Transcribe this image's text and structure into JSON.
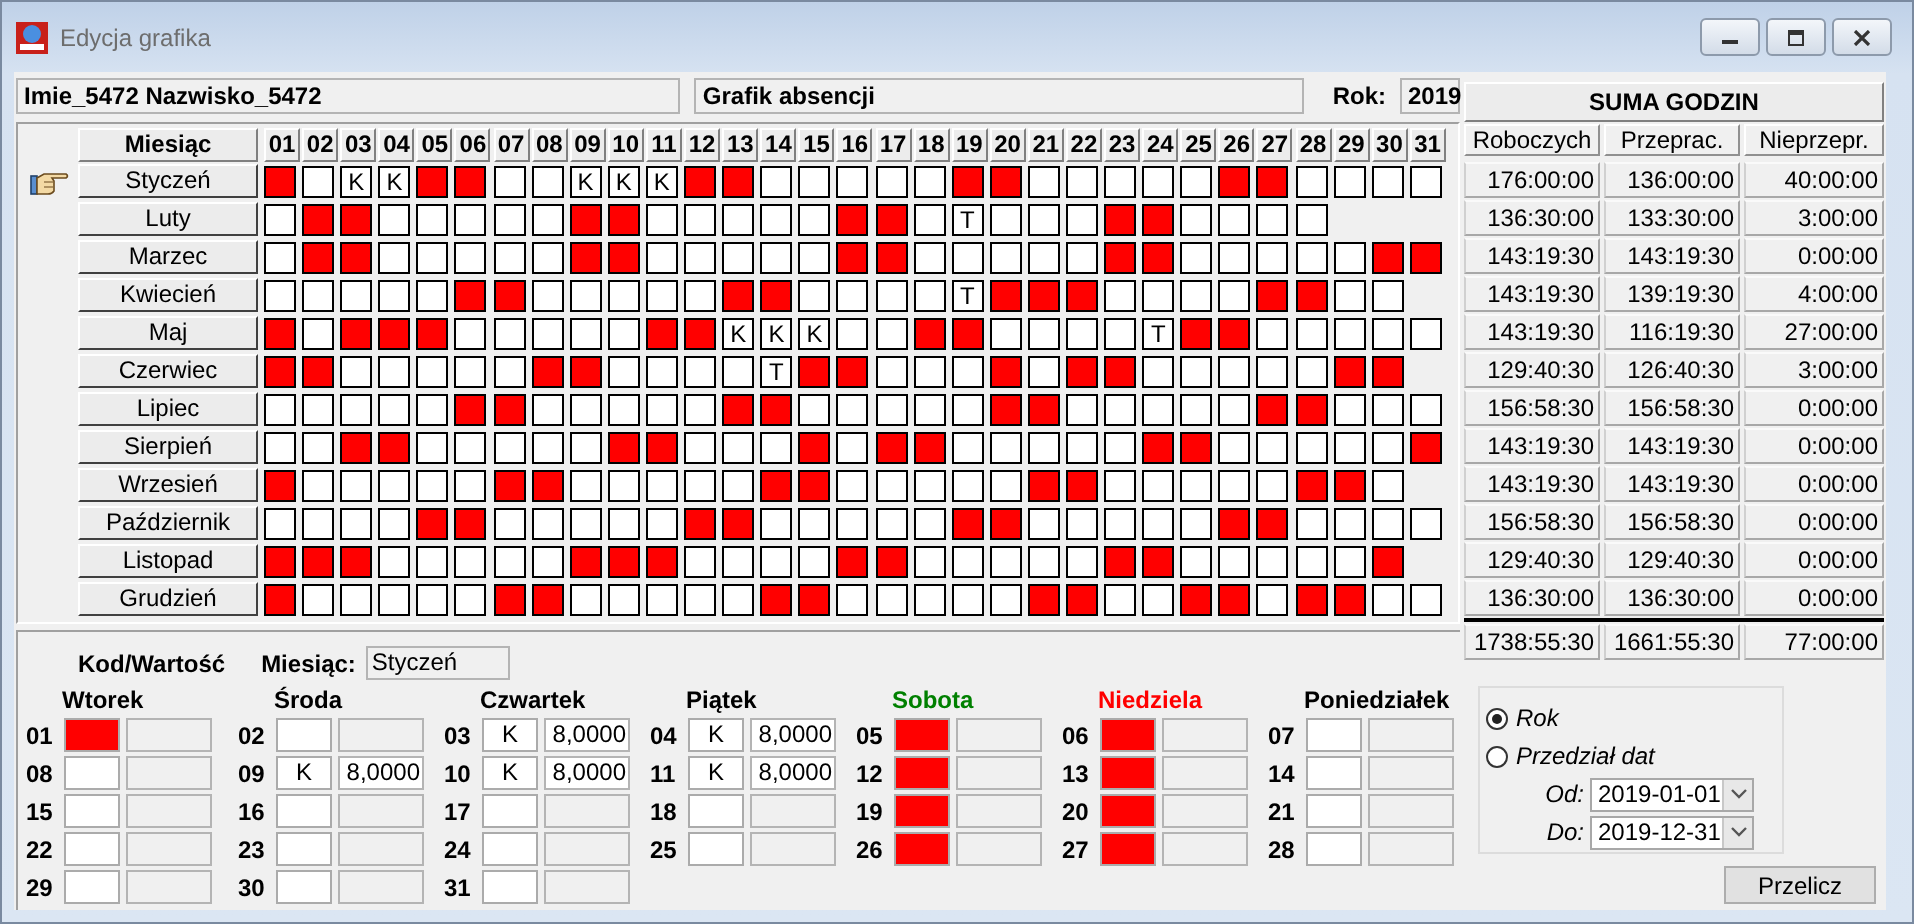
{
  "window": {
    "title": "Edycja grafika"
  },
  "header": {
    "employee": "Imie_5472 Nazwisko_5472",
    "schedule": "Grafik absencji",
    "year_label": "Rok:",
    "year": "2019"
  },
  "grid": {
    "month_heading": "Miesiąc",
    "day_headings": [
      "01",
      "02",
      "03",
      "04",
      "05",
      "06",
      "07",
      "08",
      "09",
      "10",
      "11",
      "12",
      "13",
      "14",
      "15",
      "16",
      "17",
      "18",
      "19",
      "20",
      "21",
      "22",
      "23",
      "24",
      "25",
      "26",
      "27",
      "28",
      "29",
      "30",
      "31"
    ],
    "months": [
      {
        "name": "Styczeń",
        "selected": true,
        "days": [
          {
            "off": true
          },
          {
            "off": false
          },
          {
            "off": false,
            "code": "K"
          },
          {
            "off": false,
            "code": "K"
          },
          {
            "off": true
          },
          {
            "off": true
          },
          {
            "off": false
          },
          {
            "off": false
          },
          {
            "off": false,
            "code": "K"
          },
          {
            "off": false,
            "code": "K"
          },
          {
            "off": false,
            "code": "K"
          },
          {
            "off": true
          },
          {
            "off": true
          },
          {
            "off": false
          },
          {
            "off": false
          },
          {
            "off": false
          },
          {
            "off": false
          },
          {
            "off": false
          },
          {
            "off": true
          },
          {
            "off": true
          },
          {
            "off": false
          },
          {
            "off": false
          },
          {
            "off": false
          },
          {
            "off": false
          },
          {
            "off": false
          },
          {
            "off": true
          },
          {
            "off": true
          },
          {
            "off": false
          },
          {
            "off": false
          },
          {
            "off": false
          },
          {
            "off": false
          }
        ]
      },
      {
        "name": "Luty",
        "selected": false,
        "days": [
          {
            "off": false
          },
          {
            "off": true
          },
          {
            "off": true
          },
          {
            "off": false
          },
          {
            "off": false
          },
          {
            "off": false
          },
          {
            "off": false
          },
          {
            "off": false
          },
          {
            "off": true
          },
          {
            "off": true
          },
          {
            "off": false
          },
          {
            "off": false
          },
          {
            "off": false
          },
          {
            "off": false
          },
          {
            "off": false
          },
          {
            "off": true
          },
          {
            "off": true
          },
          {
            "off": false
          },
          {
            "off": false,
            "code": "T"
          },
          {
            "off": false
          },
          {
            "off": false
          },
          {
            "off": false
          },
          {
            "off": true
          },
          {
            "off": true
          },
          {
            "off": false
          },
          {
            "off": false
          },
          {
            "off": false
          },
          {
            "off": false
          }
        ]
      },
      {
        "name": "Marzec",
        "selected": false,
        "days": [
          {
            "off": false
          },
          {
            "off": true
          },
          {
            "off": true
          },
          {
            "off": false
          },
          {
            "off": false
          },
          {
            "off": false
          },
          {
            "off": false
          },
          {
            "off": false
          },
          {
            "off": true
          },
          {
            "off": true
          },
          {
            "off": false
          },
          {
            "off": false
          },
          {
            "off": false
          },
          {
            "off": false
          },
          {
            "off": false
          },
          {
            "off": true
          },
          {
            "off": true
          },
          {
            "off": false
          },
          {
            "off": false
          },
          {
            "off": false
          },
          {
            "off": false
          },
          {
            "off": false
          },
          {
            "off": true
          },
          {
            "off": true
          },
          {
            "off": false
          },
          {
            "off": false
          },
          {
            "off": false
          },
          {
            "off": false
          },
          {
            "off": false
          },
          {
            "off": true
          },
          {
            "off": true
          }
        ]
      },
      {
        "name": "Kwiecień",
        "selected": false,
        "days": [
          {
            "off": false
          },
          {
            "off": false
          },
          {
            "off": false
          },
          {
            "off": false
          },
          {
            "off": false
          },
          {
            "off": true
          },
          {
            "off": true
          },
          {
            "off": false
          },
          {
            "off": false
          },
          {
            "off": false
          },
          {
            "off": false
          },
          {
            "off": false
          },
          {
            "off": true
          },
          {
            "off": true
          },
          {
            "off": false
          },
          {
            "off": false
          },
          {
            "off": false
          },
          {
            "off": false
          },
          {
            "off": false,
            "code": "T"
          },
          {
            "off": true
          },
          {
            "off": true
          },
          {
            "off": true
          },
          {
            "off": false
          },
          {
            "off": false
          },
          {
            "off": false
          },
          {
            "off": false
          },
          {
            "off": true
          },
          {
            "off": true
          },
          {
            "off": false
          },
          {
            "off": false
          }
        ]
      },
      {
        "name": "Maj",
        "selected": false,
        "days": [
          {
            "off": true
          },
          {
            "off": false
          },
          {
            "off": true
          },
          {
            "off": true
          },
          {
            "off": true
          },
          {
            "off": false
          },
          {
            "off": false
          },
          {
            "off": false
          },
          {
            "off": false
          },
          {
            "off": false
          },
          {
            "off": true
          },
          {
            "off": true
          },
          {
            "off": false,
            "code": "K"
          },
          {
            "off": false,
            "code": "K"
          },
          {
            "off": false,
            "code": "K"
          },
          {
            "off": false
          },
          {
            "off": false
          },
          {
            "off": true
          },
          {
            "off": true
          },
          {
            "off": false
          },
          {
            "off": false
          },
          {
            "off": false
          },
          {
            "off": false
          },
          {
            "off": false,
            "code": "T"
          },
          {
            "off": true
          },
          {
            "off": true
          },
          {
            "off": false
          },
          {
            "off": false
          },
          {
            "off": false
          },
          {
            "off": false
          },
          {
            "off": false
          }
        ]
      },
      {
        "name": "Czerwiec",
        "selected": false,
        "days": [
          {
            "off": true
          },
          {
            "off": true
          },
          {
            "off": false
          },
          {
            "off": false
          },
          {
            "off": false
          },
          {
            "off": false
          },
          {
            "off": false
          },
          {
            "off": true
          },
          {
            "off": true
          },
          {
            "off": false
          },
          {
            "off": false
          },
          {
            "off": false
          },
          {
            "off": false
          },
          {
            "off": false,
            "code": "T"
          },
          {
            "off": true
          },
          {
            "off": true
          },
          {
            "off": false
          },
          {
            "off": false
          },
          {
            "off": false
          },
          {
            "off": true
          },
          {
            "off": false
          },
          {
            "off": true
          },
          {
            "off": true
          },
          {
            "off": false
          },
          {
            "off": false
          },
          {
            "off": false
          },
          {
            "off": false
          },
          {
            "off": false
          },
          {
            "off": true
          },
          {
            "off": true
          }
        ]
      },
      {
        "name": "Lipiec",
        "selected": false,
        "days": [
          {
            "off": false
          },
          {
            "off": false
          },
          {
            "off": false
          },
          {
            "off": false
          },
          {
            "off": false
          },
          {
            "off": true
          },
          {
            "off": true
          },
          {
            "off": false
          },
          {
            "off": false
          },
          {
            "off": false
          },
          {
            "off": false
          },
          {
            "off": false
          },
          {
            "off": true
          },
          {
            "off": true
          },
          {
            "off": false
          },
          {
            "off": false
          },
          {
            "off": false
          },
          {
            "off": false
          },
          {
            "off": false
          },
          {
            "off": true
          },
          {
            "off": true
          },
          {
            "off": false
          },
          {
            "off": false
          },
          {
            "off": false
          },
          {
            "off": false
          },
          {
            "off": false
          },
          {
            "off": true
          },
          {
            "off": true
          },
          {
            "off": false
          },
          {
            "off": false
          },
          {
            "off": false
          }
        ]
      },
      {
        "name": "Sierpień",
        "selected": false,
        "days": [
          {
            "off": false
          },
          {
            "off": false
          },
          {
            "off": true
          },
          {
            "off": true
          },
          {
            "off": false
          },
          {
            "off": false
          },
          {
            "off": false
          },
          {
            "off": false
          },
          {
            "off": false
          },
          {
            "off": true
          },
          {
            "off": true
          },
          {
            "off": false
          },
          {
            "off": false
          },
          {
            "off": false
          },
          {
            "off": true
          },
          {
            "off": false
          },
          {
            "off": true
          },
          {
            "off": true
          },
          {
            "off": false
          },
          {
            "off": false
          },
          {
            "off": false
          },
          {
            "off": false
          },
          {
            "off": false
          },
          {
            "off": true
          },
          {
            "off": true
          },
          {
            "off": false
          },
          {
            "off": false
          },
          {
            "off": false
          },
          {
            "off": false
          },
          {
            "off": false
          },
          {
            "off": true
          }
        ]
      },
      {
        "name": "Wrzesień",
        "selected": false,
        "days": [
          {
            "off": true
          },
          {
            "off": false
          },
          {
            "off": false
          },
          {
            "off": false
          },
          {
            "off": false
          },
          {
            "off": false
          },
          {
            "off": true
          },
          {
            "off": true
          },
          {
            "off": false
          },
          {
            "off": false
          },
          {
            "off": false
          },
          {
            "off": false
          },
          {
            "off": false
          },
          {
            "off": true
          },
          {
            "off": true
          },
          {
            "off": false
          },
          {
            "off": false
          },
          {
            "off": false
          },
          {
            "off": false
          },
          {
            "off": false
          },
          {
            "off": true
          },
          {
            "off": true
          },
          {
            "off": false
          },
          {
            "off": false
          },
          {
            "off": false
          },
          {
            "off": false
          },
          {
            "off": false
          },
          {
            "off": true
          },
          {
            "off": true
          },
          {
            "off": false
          }
        ]
      },
      {
        "name": "Październik",
        "selected": false,
        "days": [
          {
            "off": false
          },
          {
            "off": false
          },
          {
            "off": false
          },
          {
            "off": false
          },
          {
            "off": true
          },
          {
            "off": true
          },
          {
            "off": false
          },
          {
            "off": false
          },
          {
            "off": false
          },
          {
            "off": false
          },
          {
            "off": false
          },
          {
            "off": true
          },
          {
            "off": true
          },
          {
            "off": false
          },
          {
            "off": false
          },
          {
            "off": false
          },
          {
            "off": false
          },
          {
            "off": false
          },
          {
            "off": true
          },
          {
            "off": true
          },
          {
            "off": false
          },
          {
            "off": false
          },
          {
            "off": false
          },
          {
            "off": false
          },
          {
            "off": false
          },
          {
            "off": true
          },
          {
            "off": true
          },
          {
            "off": false
          },
          {
            "off": false
          },
          {
            "off": false
          },
          {
            "off": false
          }
        ]
      },
      {
        "name": "Listopad",
        "selected": false,
        "days": [
          {
            "off": true
          },
          {
            "off": true
          },
          {
            "off": true
          },
          {
            "off": false
          },
          {
            "off": false
          },
          {
            "off": false
          },
          {
            "off": false
          },
          {
            "off": false
          },
          {
            "off": true
          },
          {
            "off": true
          },
          {
            "off": true
          },
          {
            "off": false
          },
          {
            "off": false
          },
          {
            "off": false
          },
          {
            "off": false
          },
          {
            "off": true
          },
          {
            "off": true
          },
          {
            "off": false
          },
          {
            "off": false
          },
          {
            "off": false
          },
          {
            "off": false
          },
          {
            "off": false
          },
          {
            "off": true
          },
          {
            "off": true
          },
          {
            "off": false
          },
          {
            "off": false
          },
          {
            "off": false
          },
          {
            "off": false
          },
          {
            "off": false
          },
          {
            "off": true
          }
        ]
      },
      {
        "name": "Grudzień",
        "selected": false,
        "days": [
          {
            "off": true
          },
          {
            "off": false
          },
          {
            "off": false
          },
          {
            "off": false
          },
          {
            "off": false
          },
          {
            "off": false
          },
          {
            "off": true
          },
          {
            "off": true
          },
          {
            "off": false
          },
          {
            "off": false
          },
          {
            "off": false
          },
          {
            "off": false
          },
          {
            "off": false
          },
          {
            "off": true
          },
          {
            "off": true
          },
          {
            "off": false
          },
          {
            "off": false
          },
          {
            "off": false
          },
          {
            "off": false
          },
          {
            "off": false
          },
          {
            "off": true
          },
          {
            "off": true
          },
          {
            "off": false
          },
          {
            "off": false
          },
          {
            "off": true
          },
          {
            "off": true
          },
          {
            "off": false
          },
          {
            "off": true
          },
          {
            "off": true
          },
          {
            "off": false
          },
          {
            "off": false
          }
        ]
      }
    ]
  },
  "summary": {
    "title": "SUMA GODZIN",
    "columns": [
      "Roboczych",
      "Przeprac.",
      "Nieprzepr."
    ],
    "rows": [
      [
        "176:00:00",
        "136:00:00",
        "40:00:00"
      ],
      [
        "136:30:00",
        "133:30:00",
        "3:00:00"
      ],
      [
        "143:19:30",
        "143:19:30",
        "0:00:00"
      ],
      [
        "143:19:30",
        "139:19:30",
        "4:00:00"
      ],
      [
        "143:19:30",
        "116:19:30",
        "27:00:00"
      ],
      [
        "129:40:30",
        "126:40:30",
        "3:00:00"
      ],
      [
        "156:58:30",
        "156:58:30",
        "0:00:00"
      ],
      [
        "143:19:30",
        "143:19:30",
        "0:00:00"
      ],
      [
        "143:19:30",
        "143:19:30",
        "0:00:00"
      ],
      [
        "156:58:30",
        "156:58:30",
        "0:00:00"
      ],
      [
        "129:40:30",
        "129:40:30",
        "0:00:00"
      ],
      [
        "136:30:00",
        "136:30:00",
        "0:00:00"
      ]
    ],
    "total": [
      "1738:55:30",
      "1661:55:30",
      "77:00:00"
    ]
  },
  "detail": {
    "code_value_label": "Kod/Wartość",
    "month_label": "Miesiąc:",
    "month": "Styczeń",
    "weekdays": [
      {
        "name": "Wtorek",
        "color": "#000000",
        "days": [
          {
            "day": "01",
            "off": true
          },
          {
            "day": "08",
            "off": false
          },
          {
            "day": "15",
            "off": false
          },
          {
            "day": "22",
            "off": false
          },
          {
            "day": "29",
            "off": false
          }
        ]
      },
      {
        "name": "Środa",
        "color": "#000000",
        "days": [
          {
            "day": "02",
            "off": false
          },
          {
            "day": "09",
            "off": false,
            "code": "K",
            "value": "8,0000"
          },
          {
            "day": "16",
            "off": false
          },
          {
            "day": "23",
            "off": false
          },
          {
            "day": "30",
            "off": false
          }
        ]
      },
      {
        "name": "Czwartek",
        "color": "#000000",
        "days": [
          {
            "day": "03",
            "off": false,
            "code": "K",
            "value": "8,0000"
          },
          {
            "day": "10",
            "off": false,
            "code": "K",
            "value": "8,0000"
          },
          {
            "day": "17",
            "off": false
          },
          {
            "day": "24",
            "off": false
          },
          {
            "day": "31",
            "off": false
          }
        ]
      },
      {
        "name": "Piątek",
        "color": "#000000",
        "days": [
          {
            "day": "04",
            "off": false,
            "code": "K",
            "value": "8,0000"
          },
          {
            "day": "11",
            "off": false,
            "code": "K",
            "value": "8,0000"
          },
          {
            "day": "18",
            "off": false
          },
          {
            "day": "25",
            "off": false
          }
        ]
      },
      {
        "name": "Sobota",
        "color": "#008000",
        "days": [
          {
            "day": "05",
            "off": true
          },
          {
            "day": "12",
            "off": true
          },
          {
            "day": "19",
            "off": true
          },
          {
            "day": "26",
            "off": true
          }
        ]
      },
      {
        "name": "Niedziela",
        "color": "#ff0000",
        "days": [
          {
            "day": "06",
            "off": true
          },
          {
            "day": "13",
            "off": true
          },
          {
            "day": "20",
            "off": true
          },
          {
            "day": "27",
            "off": true
          }
        ]
      },
      {
        "name": "Poniedziałek",
        "color": "#000000",
        "days": [
          {
            "day": "07",
            "off": false
          },
          {
            "day": "14",
            "off": false
          },
          {
            "day": "21",
            "off": false
          },
          {
            "day": "28",
            "off": false
          }
        ]
      }
    ]
  },
  "range": {
    "options": [
      {
        "label": "Rok",
        "selected": true
      },
      {
        "label": "Przedział dat",
        "selected": false
      }
    ],
    "from_label": "Od:",
    "from": "2019-01-01",
    "to_label": "Do:",
    "to": "2019-12-31"
  },
  "recalc_button": "Przelicz"
}
